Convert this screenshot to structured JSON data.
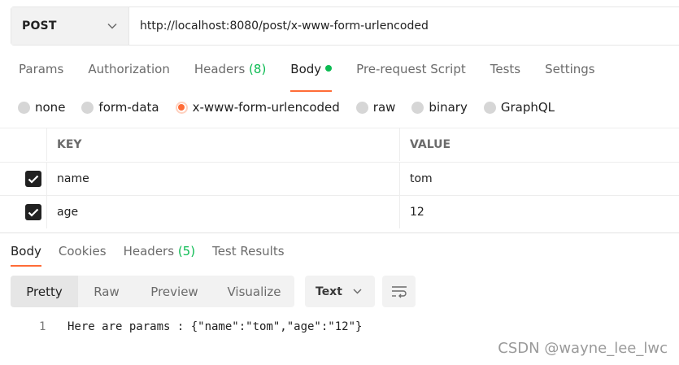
{
  "request": {
    "method": "POST",
    "url": "http://localhost:8080/post/x-www-form-urlencoded"
  },
  "request_tabs": [
    {
      "label": "Params"
    },
    {
      "label": "Authorization"
    },
    {
      "label": "Headers",
      "count": "(8)"
    },
    {
      "label": "Body"
    },
    {
      "label": "Pre-request Script"
    },
    {
      "label": "Tests"
    },
    {
      "label": "Settings"
    }
  ],
  "body_types": [
    {
      "label": "none"
    },
    {
      "label": "form-data"
    },
    {
      "label": "x-www-form-urlencoded"
    },
    {
      "label": "raw"
    },
    {
      "label": "binary"
    },
    {
      "label": "GraphQL"
    }
  ],
  "params_table": {
    "headers": {
      "key": "KEY",
      "value": "VALUE"
    },
    "rows": [
      {
        "key": "name",
        "value": "tom"
      },
      {
        "key": "age",
        "value": "12"
      }
    ]
  },
  "response_tabs": [
    {
      "label": "Body"
    },
    {
      "label": "Cookies"
    },
    {
      "label": "Headers",
      "count": "(5)"
    },
    {
      "label": "Test Results"
    }
  ],
  "view_modes": [
    "Pretty",
    "Raw",
    "Preview",
    "Visualize"
  ],
  "format": "Text",
  "response_body": {
    "line_number": "1",
    "text": "Here are params : {\"name\":\"tom\",\"age\":\"12\"}"
  },
  "watermark": "CSDN @wayne_lee_lwc",
  "colors": {
    "accent": "#ff6c37",
    "green": "#0cbb52"
  }
}
